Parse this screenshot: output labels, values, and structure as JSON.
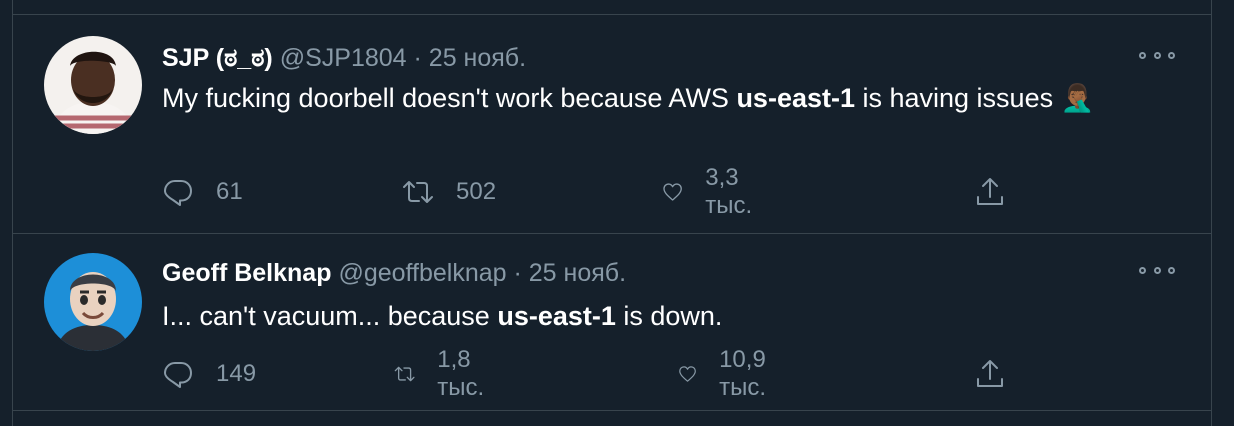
{
  "tweets": [
    {
      "name": "SJP (ಠ_ಠ)",
      "handle": "@SJP1804",
      "separator": "·",
      "date": "25 нояб.",
      "text_before": "My fucking doorbell doesn't work because AWS ",
      "text_bold": "us-east-1",
      "text_after": " is having issues ",
      "emoji": "🤦🏾‍♂️",
      "replies": "61",
      "retweets": "502",
      "likes": "3,3 тыс."
    },
    {
      "name": "Geoff Belknap",
      "handle": "@geoffbelknap",
      "separator": "·",
      "date": "25 нояб.",
      "text_before": "I... can't vacuum... because ",
      "text_bold": "us-east-1",
      "text_after": " is down.",
      "replies": "149",
      "retweets": "1,8 тыс.",
      "likes": "10,9 тыс."
    }
  ],
  "icons": {
    "reply": "reply-icon",
    "retweet": "retweet-icon",
    "like": "like-icon",
    "share": "share-icon",
    "more": "more-icon"
  },
  "colors": {
    "background": "#15202b",
    "border": "#38444d",
    "secondary_text": "#8899a6",
    "primary_text": "#ffffff",
    "avatar2_background": "#1d8fd8"
  }
}
